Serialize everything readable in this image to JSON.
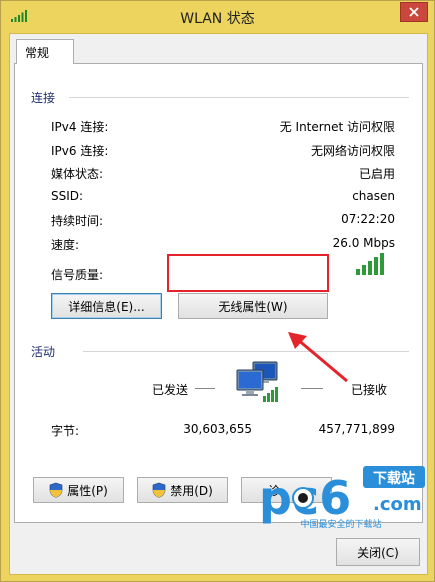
{
  "window": {
    "title": "WLAN 状态",
    "colors": {
      "frame": "#ecd45f",
      "close": "#c9473c",
      "highlight": "#e5232a"
    }
  },
  "tabs": [
    {
      "label": "常规"
    }
  ],
  "connection": {
    "heading": "连接",
    "rows": [
      {
        "label": "IPv4 连接:",
        "value": "无 Internet 访问权限"
      },
      {
        "label": "IPv6 连接:",
        "value": "无网络访问权限"
      },
      {
        "label": "媒体状态:",
        "value": "已启用"
      },
      {
        "label": "SSID:",
        "value": "chasen"
      },
      {
        "label": "持续时间:",
        "value": "07:22:20"
      },
      {
        "label": "速度:",
        "value": "26.0 Mbps"
      },
      {
        "label": "信号质量:",
        "value": ""
      }
    ],
    "signal_bars": 5,
    "details_button": "详细信息(E)...",
    "wireless_props_button": "无线属性(W)"
  },
  "activity": {
    "heading": "活动",
    "sent_label": "已发送",
    "received_label": "已接收",
    "bytes_label": "字节:",
    "bytes_sent": "30,603,655",
    "bytes_received": "457,771,899"
  },
  "actions": {
    "properties": "属性(P)",
    "disable": "禁用(D)",
    "diagnose_partial": "诊"
  },
  "close_button": "关闭(C)",
  "watermark": {
    "brand": "pc6",
    "tag": "下载站",
    "url": ".com",
    "slogan": "中国最安全的下载站"
  }
}
